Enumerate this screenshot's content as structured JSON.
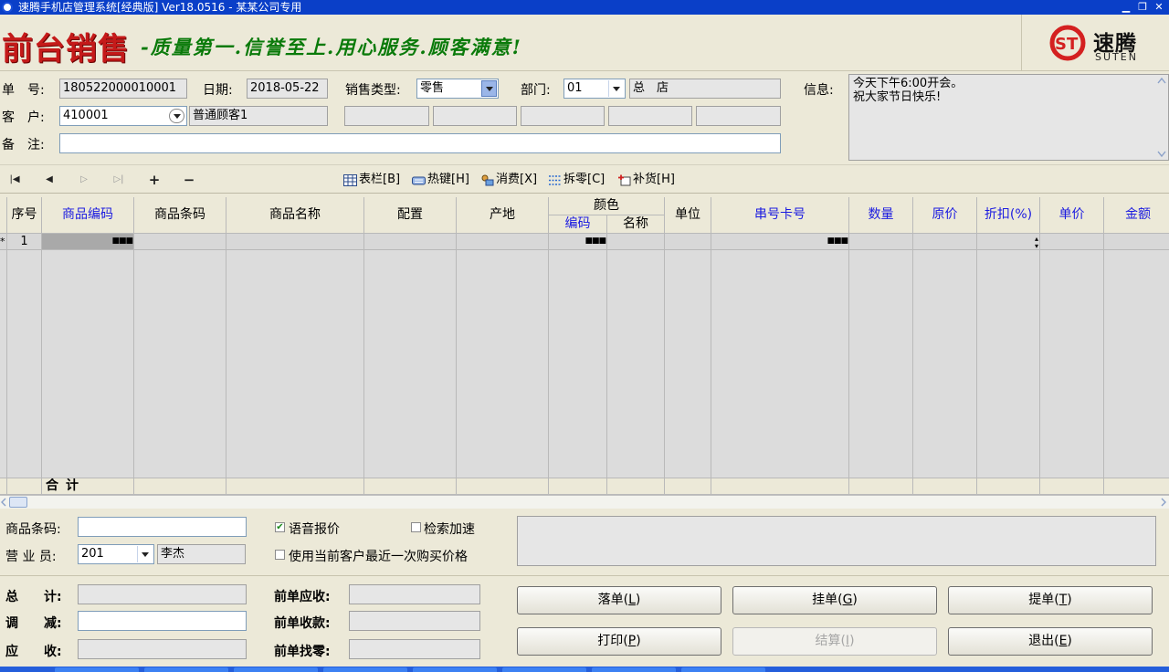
{
  "window": {
    "title": "速腾手机店管理系统[经典版] Ver18.0516  -  某某公司专用",
    "minimize": "▁",
    "restore": "❐"
  },
  "banner": {
    "heading": "前台销售",
    "slogan": "-质量第一.信誉至上.用心服务.顾客满意!",
    "logo_cn": "速腾",
    "logo_en": "SUTEN",
    "logo_color": "#d42020"
  },
  "form": {
    "order_no": {
      "label": "单　号:",
      "value": "180522000010001"
    },
    "date": {
      "label": "日期:",
      "value": "2018-05-22"
    },
    "sale_type": {
      "label": "销售类型:",
      "value": "零售"
    },
    "dept": {
      "label": "部门:",
      "code": "01",
      "name": "总　店"
    },
    "info": {
      "label": "信息:",
      "lines": [
        "今天下午6:00开会。",
        "祝大家节日快乐!"
      ]
    },
    "customer": {
      "label": "客　户:",
      "code": "410001",
      "name": "普通顾客1"
    },
    "remark": {
      "label": "备　注:",
      "value": ""
    }
  },
  "toolbar": {
    "nav": [
      "|◀",
      "◀",
      "▷",
      "▷|",
      "+",
      "−"
    ],
    "buttons": [
      {
        "icon": "table-icon",
        "label": "表栏[B]"
      },
      {
        "icon": "keyboard-icon",
        "label": "热键[H]"
      },
      {
        "icon": "consume-icon",
        "label": "消费[X]"
      },
      {
        "icon": "split-icon",
        "label": "拆零[C]"
      },
      {
        "icon": "restock-icon",
        "label": "补货[H]"
      }
    ]
  },
  "grid": {
    "columns": [
      "序号",
      "商品编码",
      "商品条码",
      "商品名称",
      "配置",
      "产地",
      "单位",
      "串号卡号",
      "数量",
      "原价",
      "折扣(%)",
      "单价",
      "金额"
    ],
    "color_group": {
      "label": "颜色",
      "sub": [
        "编码",
        "名称"
      ]
    },
    "rows": [
      {
        "marker": "*",
        "seq": "1"
      }
    ],
    "footer": "合计"
  },
  "bottom": {
    "barcode": {
      "label": "商品条码:",
      "value": ""
    },
    "salesperson": {
      "label": "营 业 员:",
      "code": "201",
      "name": "李杰"
    },
    "voice_quote": {
      "label": "语音报价",
      "checked": true
    },
    "search_speedup": {
      "label": "检索加速",
      "checked": false
    },
    "last_price": {
      "label": "使用当前客户最近一次购买价格",
      "checked": false
    },
    "total": {
      "label": "总　　计:",
      "value": ""
    },
    "adjust": {
      "label": "调　　减:",
      "value": ""
    },
    "receivable": {
      "label": "应　　收:",
      "value": ""
    },
    "prev_receivable": {
      "label": "前单应收:",
      "value": ""
    },
    "prev_received": {
      "label": "前单收款:",
      "value": ""
    },
    "prev_change": {
      "label": "前单找零:",
      "value": ""
    }
  },
  "actions": {
    "save": {
      "text": "落单(",
      "key": "L",
      "end": ")"
    },
    "hold": {
      "text": "挂单(",
      "key": "G",
      "end": ")"
    },
    "fetch": {
      "text": "提单(",
      "key": "T",
      "end": ")"
    },
    "print": {
      "text": "打印(",
      "key": "P",
      "end": ")"
    },
    "settle": {
      "text": "结算(",
      "key": "I",
      "end": ")"
    },
    "exit": {
      "text": "退出(",
      "key": "E",
      "end": ")"
    }
  }
}
